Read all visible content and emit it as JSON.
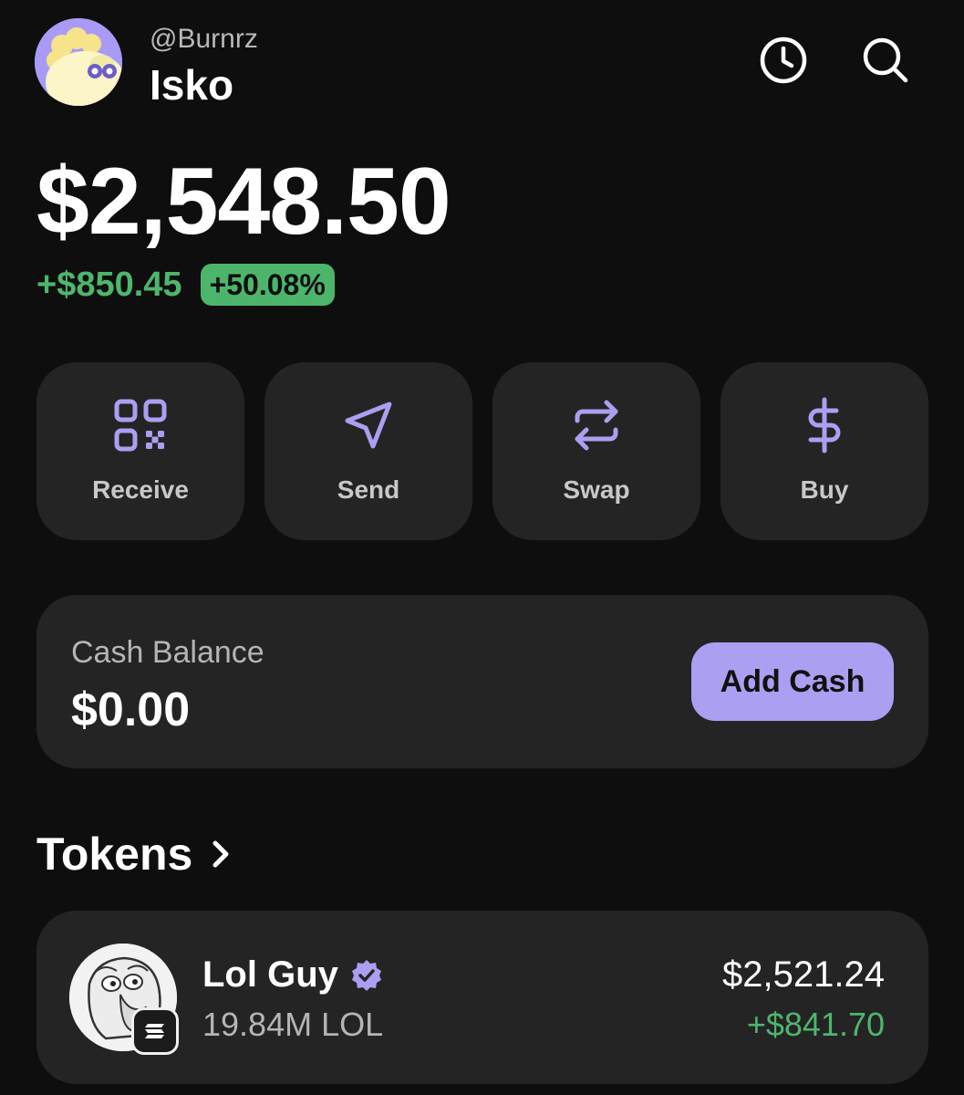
{
  "header": {
    "handle": "@Burnrz",
    "username": "Isko",
    "icons": [
      "clock-icon",
      "search-icon"
    ]
  },
  "portfolio": {
    "balance": "$2,548.50",
    "change_amount": "+$850.45",
    "change_percent": "+50.08%"
  },
  "actions": [
    {
      "label": "Receive",
      "icon": "qr-code-icon"
    },
    {
      "label": "Send",
      "icon": "send-icon"
    },
    {
      "label": "Swap",
      "icon": "swap-icon"
    },
    {
      "label": "Buy",
      "icon": "dollar-icon"
    }
  ],
  "cash": {
    "label": "Cash Balance",
    "value": "$0.00",
    "button_label": "Add Cash"
  },
  "tokens": {
    "title": "Tokens",
    "items": [
      {
        "name": "Lol Guy",
        "amount": "19.84M LOL",
        "value": "$2,521.24",
        "change": "+$841.70",
        "verified": true
      }
    ]
  },
  "colors": {
    "background": "#0e0e0e",
    "card": "#242424",
    "accent": "#ab9ff2",
    "positive": "#4fb56d"
  }
}
